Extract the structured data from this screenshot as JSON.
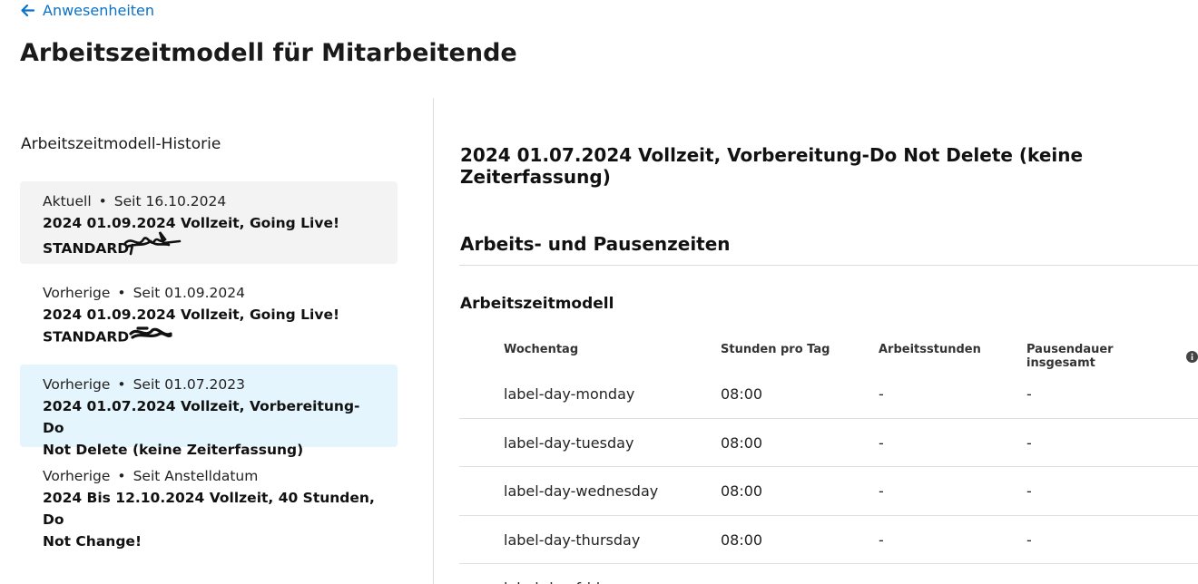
{
  "nav": {
    "back_label": "Anwesenheiten"
  },
  "page": {
    "title": "Arbeitszeitmodell für Mitarbeitende"
  },
  "history": {
    "heading": "Arbeitszeitmodell-Historie",
    "items": [
      {
        "status": "Aktuell",
        "since": "Seit 16.10.2024",
        "title_line1": "2024 01.09.2024 Vollzeit, Going Live!",
        "title_line2": "STANDARD"
      },
      {
        "status": "Vorherige",
        "since": "Seit 01.09.2024",
        "title_line1": "2024 01.09.2024 Vollzeit, Going Live!",
        "title_line2": "STANDARD"
      },
      {
        "status": "Vorherige",
        "since": "Seit 01.07.2023",
        "title_line1": "2024 01.07.2024 Vollzeit, Vorbereitung-Do",
        "title_line2": "Not Delete (keine Zeiterfassung)"
      },
      {
        "status": "Vorherige",
        "since": "Seit Anstelldatum",
        "title_line1": "2024 Bis 12.10.2024 Vollzeit, 40 Stunden, Do",
        "title_line2": "Not Change!"
      }
    ]
  },
  "detail": {
    "model_title": "2024 01.07.2024 Vollzeit, Vorbereitung-Do Not Delete (keine Zeiterfassung)",
    "section_heading": "Arbeits- und Pausenzeiten",
    "sub_heading": "Arbeitszeitmodell",
    "columns": [
      "Wochentag",
      "Stunden pro Tag",
      "Arbeitsstunden",
      "Pausendauer insgesamt"
    ],
    "rows": [
      [
        "label-day-monday",
        "08:00",
        "-",
        "-"
      ],
      [
        "label-day-tuesday",
        "08:00",
        "-",
        "-"
      ],
      [
        "label-day-wednesday",
        "08:00",
        "-",
        "-"
      ],
      [
        "label-day-thursday",
        "08:00",
        "-",
        "-"
      ],
      [
        "label-day-friday",
        "",
        "",
        ""
      ]
    ]
  },
  "colors": {
    "link": "#0a72c8",
    "current_bg": "#f3f3f3",
    "selected_bg": "#e4f5fd"
  }
}
